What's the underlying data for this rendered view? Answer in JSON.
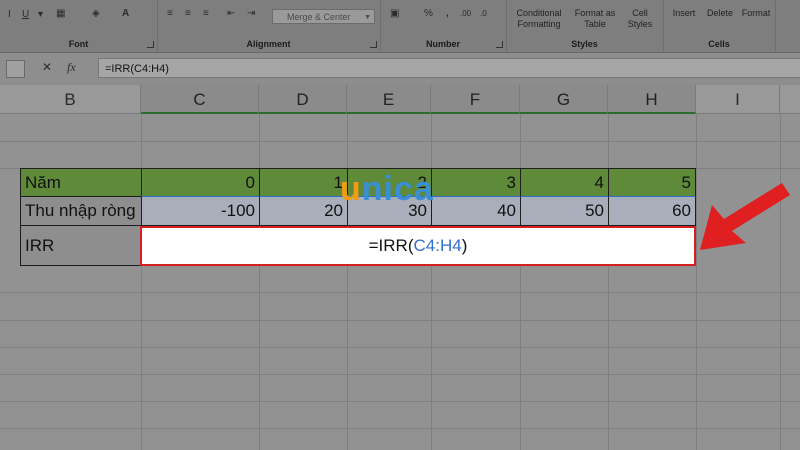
{
  "ribbon": {
    "groups": {
      "font": "Font",
      "alignment": "Alignment",
      "number": "Number",
      "styles": "Styles",
      "cells": "Cells"
    },
    "merge_center": "Merge & Center",
    "styles_buttons": [
      "Conditional Formatting",
      "Format as Table",
      "Cell Styles"
    ],
    "cells_buttons": [
      "Insert",
      "Delete",
      "Format"
    ]
  },
  "formula_bar": {
    "cancel": "✕",
    "enter": "✓",
    "fx": "fx",
    "formula": "=IRR(C4:H4)"
  },
  "columns": [
    "B",
    "C",
    "D",
    "E",
    "F",
    "G",
    "H",
    "I"
  ],
  "table": {
    "year_label": "Năm",
    "years": [
      "0",
      "1",
      "2",
      "3",
      "4",
      "5"
    ],
    "income_label": "Thu nhập ròng",
    "income": [
      "-100",
      "20",
      "30",
      "40",
      "50",
      "60"
    ],
    "irr_label": "IRR",
    "irr_formula_prefix": "=IRR(",
    "irr_formula_ref": "C4:H4",
    "irr_formula_suffix": ")"
  },
  "watermark": {
    "first": "u",
    "rest": "nica"
  },
  "colors": {
    "header_green": "#5e8a3a",
    "income_fill": "#a9aebb",
    "highlight_red": "#d42020",
    "arrow_red": "#e02020",
    "reference_blue": "#2f6fcc"
  }
}
